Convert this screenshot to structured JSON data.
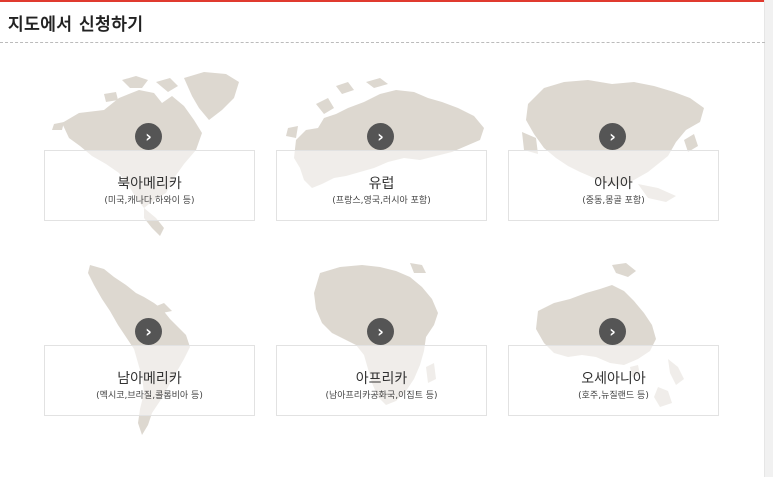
{
  "page": {
    "title": "지도에서 신청하기",
    "accent_color": "#e03a2f",
    "map_color": "#ddd8d0"
  },
  "regions": [
    {
      "name": "북아메리카",
      "desc": "(미국,캐나다,하와이 등)",
      "arrow_icon": "chevron-right-icon"
    },
    {
      "name": "유럽",
      "desc": "(프랑스,영국,러시아 포함)",
      "arrow_icon": "chevron-right-icon"
    },
    {
      "name": "아시아",
      "desc": "(중동,몽골 포함)",
      "arrow_icon": "chevron-right-icon"
    },
    {
      "name": "남아메리카",
      "desc": "(멕시코,브라질,콜롬비아 등)",
      "arrow_icon": "chevron-right-icon"
    },
    {
      "name": "아프리카",
      "desc": "(남아프리카공화국,이집트 등)",
      "arrow_icon": "chevron-right-icon"
    },
    {
      "name": "오세아니아",
      "desc": "(호주,뉴질랜드 등)",
      "arrow_icon": "chevron-right-icon"
    }
  ]
}
